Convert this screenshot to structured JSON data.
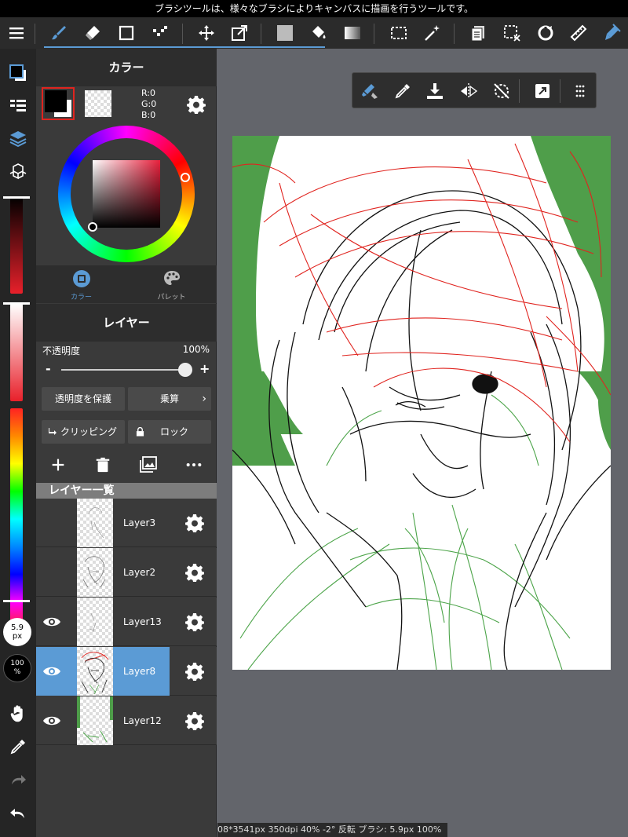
{
  "tooltip": "ブラシツールは、様々なブラシによりキャンバスに描画を行うツールです。",
  "color_panel": {
    "title": "カラー",
    "rgb": {
      "r": "R:0",
      "g": "G:0",
      "b": "B:0"
    },
    "tabs": [
      {
        "label": "カラー",
        "icon": "color-circle-icon"
      },
      {
        "label": "パレット",
        "icon": "palette-icon"
      }
    ]
  },
  "layer_panel": {
    "title": "レイヤー",
    "opacity_label": "不透明度",
    "opacity_value": "100%",
    "opacity_fraction": 1.0,
    "minus": "-",
    "plus": "+",
    "protect_alpha": "透明度を保護",
    "blend_mode": "乗算",
    "clipping": "クリッピング",
    "lock": "ロック",
    "list_header": "レイヤー一覧",
    "layers": [
      {
        "name": "Layer3",
        "visible": false,
        "selected": false
      },
      {
        "name": "Layer2",
        "visible": false,
        "selected": false
      },
      {
        "name": "Layer13",
        "visible": true,
        "selected": false
      },
      {
        "name": "Layer8",
        "visible": true,
        "selected": true
      },
      {
        "name": "Layer12",
        "visible": true,
        "selected": false
      }
    ]
  },
  "left_bar": {
    "brush_size": "5.9",
    "brush_size_unit": "px",
    "brush_opacity": "100",
    "brush_opacity_unit": "%"
  },
  "status_bar": "08*3541px 350dpi 40% -2° 反転 ブラシ: 5.9px 100%",
  "colors": {
    "accent": "#5b9bd5",
    "toolbar": "#2b2b2b",
    "panel": "#3a3a3a",
    "canvas_green": "#4f9e4a",
    "sketch_red": "#e0241f",
    "sketch_green": "#4ca449"
  }
}
